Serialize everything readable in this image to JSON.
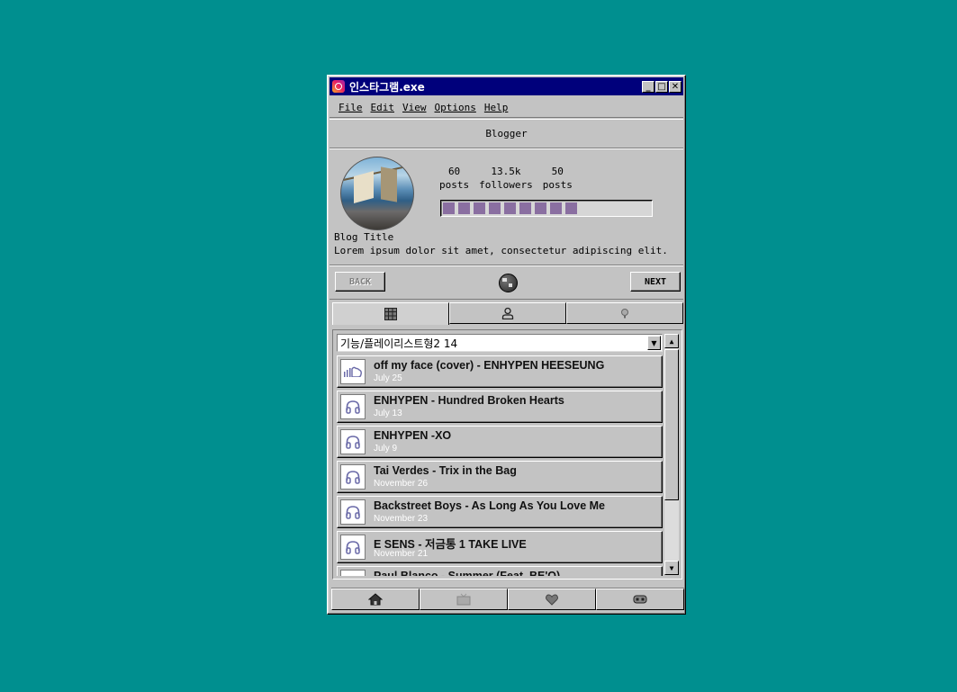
{
  "window": {
    "title": "인스타그램.exe",
    "min_label": "_",
    "max_label": "□",
    "close_label": "✕"
  },
  "menu": [
    "File",
    "Edit",
    "View",
    "Options",
    "Help"
  ],
  "heading": "Blogger",
  "profile": {
    "stats": [
      {
        "value": "60",
        "label": "posts"
      },
      {
        "value": "13.5k",
        "label": "followers"
      },
      {
        "value": "50",
        "label": "posts"
      }
    ],
    "progress_fraction": 0.68,
    "progress_segments_filled": 9,
    "blog_title": "Blog Title",
    "blog_description": "Lorem ipsum dolor sit amet, consectetur adipiscing elit."
  },
  "nav": {
    "back_label": "BACK",
    "next_label": "NEXT"
  },
  "tabs": [
    {
      "icon": "grid-icon",
      "active": true
    },
    {
      "icon": "user-icon",
      "active": false
    },
    {
      "icon": "pin-icon",
      "active": false
    }
  ],
  "playlist": {
    "selected": "기능/플레이리스트형2 14",
    "items": [
      {
        "title": "off my face (cover) - ENHYPEN HEESEUNG",
        "date": "July 25",
        "icon": "soundcloud-icon"
      },
      {
        "title": "ENHYPEN - Hundred Broken Hearts",
        "date": "July 13",
        "icon": "headphones-icon"
      },
      {
        "title": "ENHYPEN -XO",
        "date": "July 9",
        "icon": "headphones-icon"
      },
      {
        "title": "Tai Verdes - Trix in the Bag",
        "date": "November 26",
        "icon": "headphones-icon"
      },
      {
        "title": "Backstreet Boys - As Long As You Love Me",
        "date": "November 23",
        "icon": "headphones-icon"
      },
      {
        "title": "E SENS - 저금통 1 TAKE LIVE",
        "date": "November 21",
        "icon": "headphones-icon"
      },
      {
        "title": "Paul Blanco - Summer (Feat. BE'O)",
        "date": "",
        "icon": "headphones-icon"
      }
    ]
  },
  "bottom_nav": [
    {
      "icon": "home-icon"
    },
    {
      "icon": "tv-icon"
    },
    {
      "icon": "heart-icon"
    },
    {
      "icon": "gamepad-icon"
    }
  ],
  "colors": {
    "desktop": "#008f8f",
    "titlebar": "#00007b",
    "progress": "#8a6fa1",
    "face": "#c3c3c3"
  }
}
